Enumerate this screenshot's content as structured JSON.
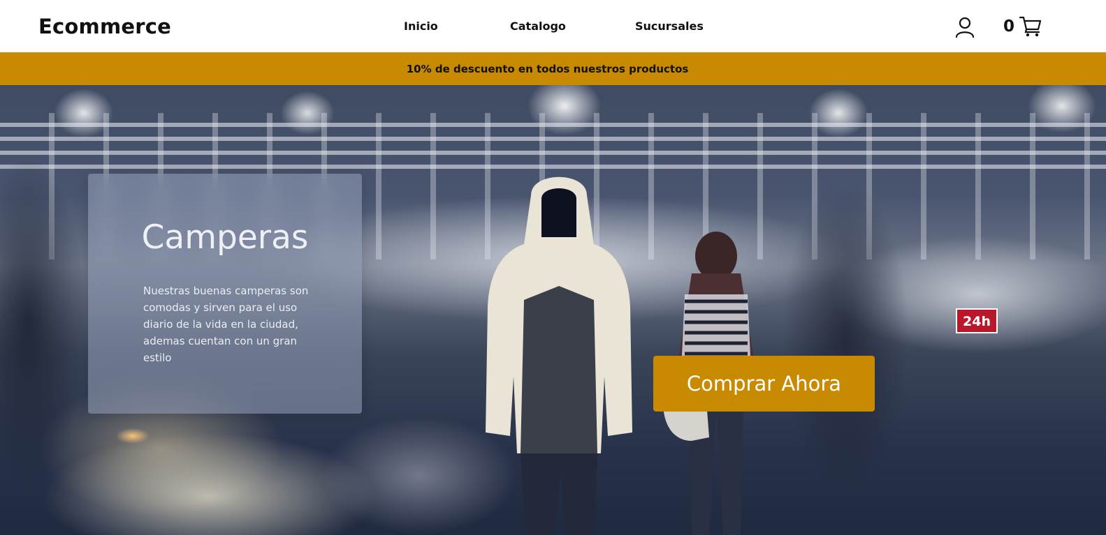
{
  "header": {
    "logo": "Ecommerce",
    "nav": {
      "inicio": "Inicio",
      "catalogo": "Catalogo",
      "sucursales": "Sucursales"
    },
    "cart_count": "0",
    "icons": {
      "user": "user-icon",
      "cart": "cart-icon"
    }
  },
  "promo": {
    "text": "10% de descuento en todos nuestros productos"
  },
  "hero": {
    "card": {
      "title": "Camperas",
      "description": "Nuestras buenas camperas son comodas y sirven para el uso diario de la vida en la ciudad, ademas cuentan con un gran estilo"
    },
    "sign_text": "24h",
    "cta_label": "Comprar Ahora"
  },
  "colors": {
    "accent": "#c88a00",
    "header_bg": "#ffffff",
    "text_dark": "#111111"
  }
}
